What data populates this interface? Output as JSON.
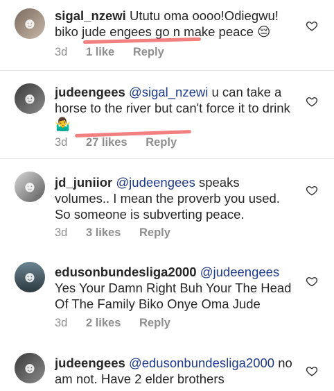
{
  "comments": [
    {
      "username": "sigal_nzewi",
      "mention": "",
      "text": "Ututu oma oooo!Odiegwu! biko jude engees go n make peace",
      "emoji": "😔",
      "time": "3d",
      "likes": "1 like",
      "reply": "Reply"
    },
    {
      "username": "judeengees",
      "mention": "@sigal_nzewi",
      "text": "u can take a horse to the river but can't force it to drink",
      "emoji": "🤷‍♂",
      "time": "3d",
      "likes": "27 likes",
      "reply": "Reply"
    },
    {
      "username": "jd_juniior",
      "mention": "@judeengees",
      "text": "speaks volumes.. I mean the proverb you used. So someone is subverting peace.",
      "emoji": "",
      "time": "3d",
      "likes": "3 likes",
      "reply": "Reply"
    },
    {
      "username": "edusonbundesliga2000",
      "mention": "@judeengees",
      "text": "Yes Your Damn Right Buh Your The Head Of The Family Biko Onye Oma Jude",
      "emoji": "",
      "time": "3d",
      "likes": "2 likes",
      "reply": "Reply"
    },
    {
      "username": "judeengees",
      "mention": "@edusonbundesliga2000",
      "text": "no am not. Have 2 elder brothers",
      "emoji": "",
      "time": "",
      "likes": "",
      "reply": ""
    }
  ],
  "icons": {
    "like": "heart-outline-icon"
  },
  "colors": {
    "mention": "#1e3a8a",
    "meta": "#8e8e8e",
    "annotation_underline": "#f06a6a"
  }
}
